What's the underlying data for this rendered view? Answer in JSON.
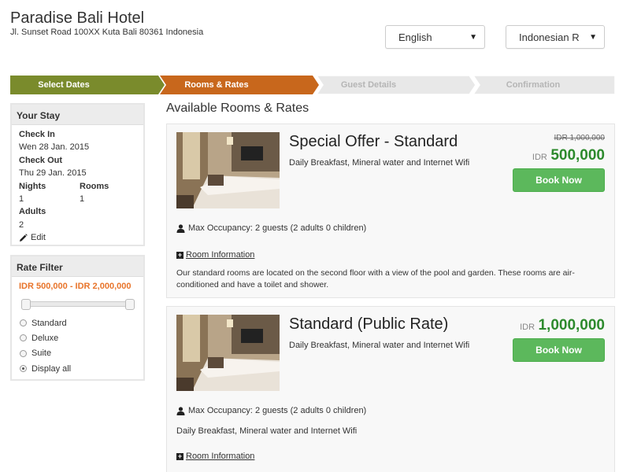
{
  "hotel": {
    "name": "Paradise Bali Hotel",
    "address": "Jl. Sunset Road 100XX Kuta Bali 80361 Indonesia"
  },
  "selectors": {
    "language": "English",
    "currency": "Indonesian R"
  },
  "steps": [
    {
      "label": "Select Dates",
      "state": "done",
      "color": "#7a8b2c"
    },
    {
      "label": "Rooms & Rates",
      "state": "active",
      "color": "#c8671c"
    },
    {
      "label": "Guest Details",
      "state": "pending",
      "color": "#e8e8e8"
    },
    {
      "label": "Confirmation",
      "state": "pending",
      "color": "#e8e8e8"
    }
  ],
  "your_stay": {
    "title": "Your Stay",
    "check_in_label": "Check In",
    "check_in_value": "Wen 28 Jan. 2015",
    "check_out_label": "Check Out",
    "check_out_value": "Thu 29 Jan. 2015",
    "nights_label": "Nights",
    "nights_value": "1",
    "rooms_label": "Rooms",
    "rooms_value": "1",
    "adults_label": "Adults",
    "adults_value": "2",
    "edit_label": "Edit"
  },
  "rate_filter": {
    "title": "Rate Filter",
    "range": "IDR 500,000 - IDR 2,000,000",
    "slider_low": 0,
    "slider_high": 1,
    "options": [
      "Standard",
      "Deluxe",
      "Suite",
      "Display all"
    ],
    "selected": "Display all"
  },
  "main": {
    "title": "Available Rooms & Rates"
  },
  "rooms": [
    {
      "name": "Special Offer - Standard",
      "includes": "Daily Breakfast, Mineral water and Internet Wifi",
      "old_price": "IDR 1,000,000",
      "currency": "IDR",
      "price": "500,000",
      "book_label": "Book Now",
      "occupancy": "Max Occupancy: 2 guests (2 adults 0 children)",
      "info_label": "Room Information",
      "description": "Our standard rooms are located on the second floor with a view of the pool and garden. These rooms are air-conditioned and have a toilet and shower."
    },
    {
      "name": "Standard (Public Rate)",
      "includes": "Daily Breakfast, Mineral water and Internet Wifi",
      "currency": "IDR",
      "price": "1,000,000",
      "book_label": "Book Now",
      "occupancy": "Max Occupancy: 2 guests (2 adults 0 children)",
      "extra": "Daily Breakfast, Mineral water and Internet Wifi",
      "info_label": "Room Information"
    }
  ]
}
